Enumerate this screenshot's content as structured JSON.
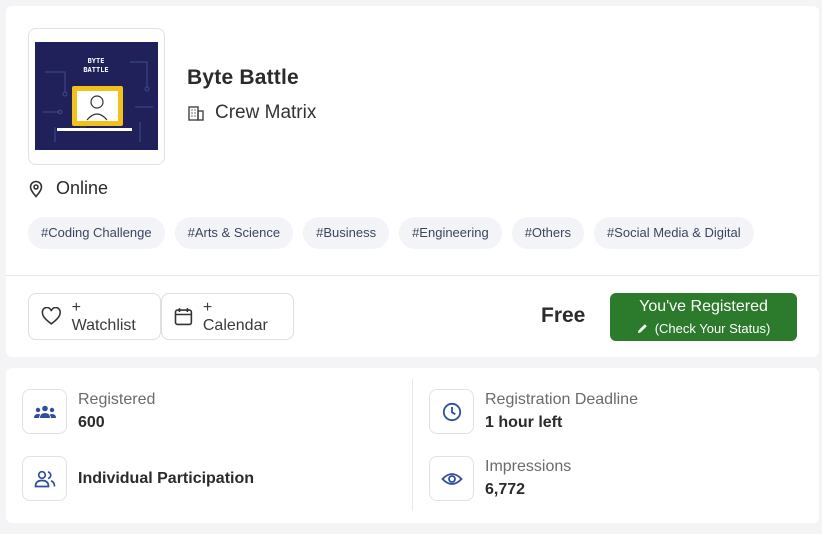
{
  "event": {
    "logo_text_line1": "BYTE",
    "logo_text_line2": "BATTLE",
    "title": "Byte Battle",
    "organizer": "Crew Matrix",
    "location": "Online",
    "tags": [
      "#Coding Challenge",
      "#Arts & Science",
      "#Business",
      "#Engineering",
      "#Others",
      "#Social Media & Digital"
    ]
  },
  "actions": {
    "watchlist_label": "+ Watchlist",
    "calendar_label": "+ Calendar",
    "price": "Free",
    "registered_label": "You've Registered",
    "check_status_label": "(Check Your Status)"
  },
  "stats": {
    "registered": {
      "label": "Registered",
      "value": "600"
    },
    "participation": {
      "value": "Individual Participation"
    },
    "deadline": {
      "label": "Registration Deadline",
      "value": "1 hour left"
    },
    "impressions": {
      "label": "Impressions",
      "value": "6,772"
    }
  },
  "icons": {
    "building": "building-icon",
    "location": "location-pin-icon",
    "heart": "heart-icon",
    "calendar": "calendar-icon",
    "pencil": "pencil-icon",
    "group": "group-icon",
    "users": "users-icon",
    "clock": "clock-icon",
    "eye": "eye-icon"
  },
  "colors": {
    "accent_green": "#2c7a2c",
    "icon_blue": "#2f4ea0",
    "tag_bg": "#f3f4f7",
    "logo_bg": "#20215a",
    "logo_yellow": "#f2c21b"
  }
}
